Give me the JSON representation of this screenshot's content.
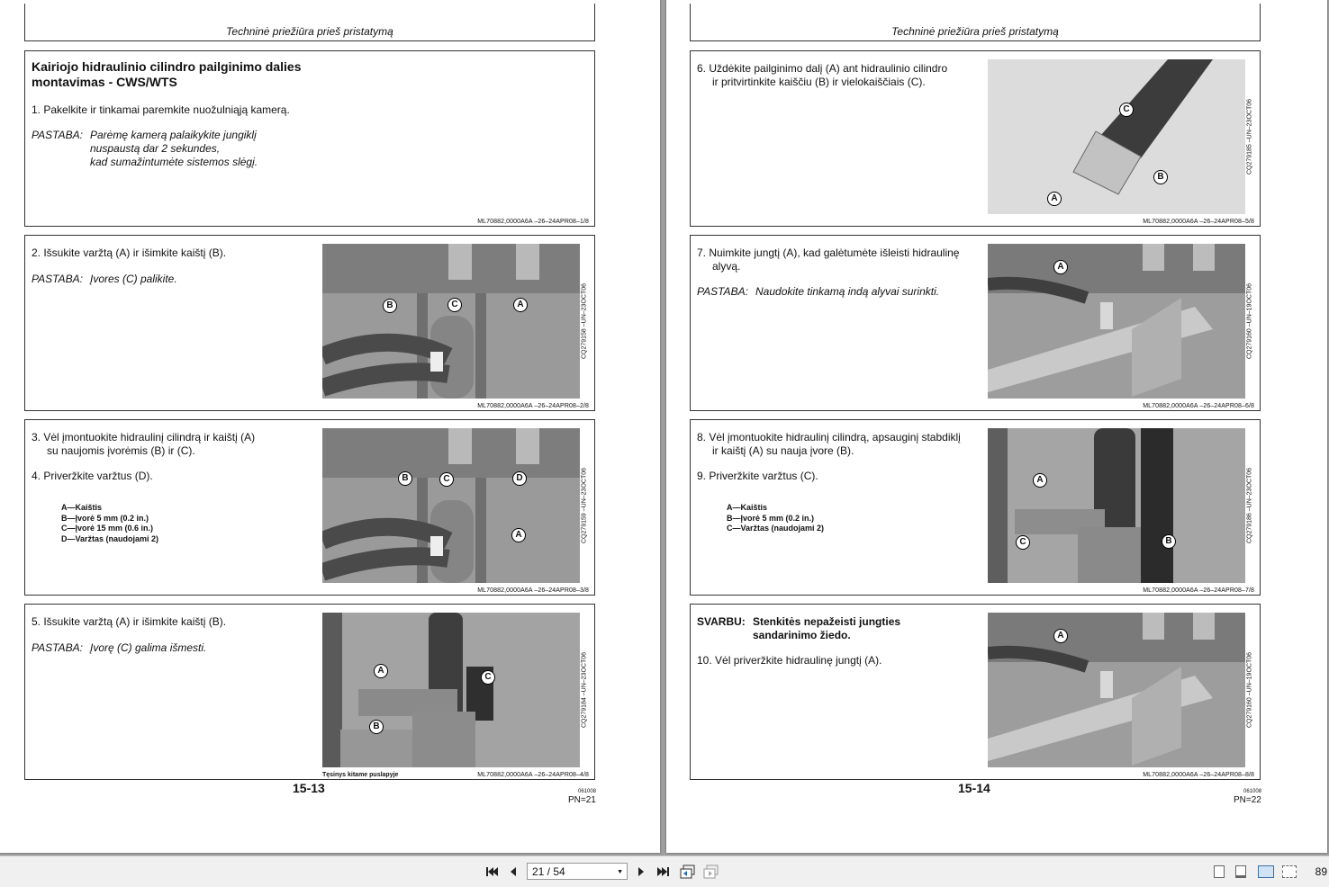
{
  "left_page": {
    "header": "Techninė priežiūra prieš pristatymą",
    "block1": {
      "title_line1": "Kairiojo hidraulinio cilindro pailginimo dalies",
      "title_line2": "montavimas - CWS/WTS",
      "step1": "1.  Pakelkite ir tinkamai paremkite nuožulniąją kamerą.",
      "note_label": "PASTABA:",
      "note_line1": "Parėmę kamerą palaikykite jungiklį",
      "note_line2": "nuspaustą dar 2 sekundes,",
      "note_line3": "kad sumažintumėte sistemos slėgį.",
      "ref": "ML70882,0000A6A   –26–24APR08–1/8"
    },
    "block2": {
      "step2": "2.  Išsukite varžtą (A) ir išimkite kaištį (B).",
      "note_label": "PASTABA:",
      "note": "Įvores (C) palikite.",
      "photo_code": "CQ279158   –UN–23OCT06",
      "ref": "ML70882,0000A6A   –26–24APR08–2/8",
      "callouts": [
        "B",
        "C",
        "A"
      ]
    },
    "block3": {
      "step3_line1": "3.  Vėl įmontuokite hidraulinį cilindrą ir kaištį (A)",
      "step3_line2": "su naujomis įvorėmis (B) ir (C).",
      "step4": "4.  Priveržkite varžtus (D).",
      "legend": [
        "A—Kaištis",
        "B—Įvorė 5 mm (0.2 in.)",
        "C—Įvorė 15 mm (0.6 in.)",
        "D—Varžtas (naudojami 2)"
      ],
      "photo_code": "CQ279159   –UN–23OCT06",
      "ref": "ML70882,0000A6A   –26–24APR08–3/8",
      "callouts": [
        "B",
        "C",
        "D",
        "A"
      ]
    },
    "block4": {
      "step5": "5.  Išsukite varžtą (A) ir išimkite kaištį (B).",
      "note_label": "PASTABA:",
      "note": "Įvorę (C) galima išmesti.",
      "photo_code": "CQ279184   –UN–23OCT06",
      "continued": "Tęsinys kitame puslapyje",
      "ref": "ML70882,0000A6A   –26–24APR08–4/8",
      "callouts": [
        "A",
        "C",
        "B"
      ]
    },
    "page_number": "15-13",
    "date": "061008",
    "pn": "PN=21"
  },
  "right_page": {
    "header": "Techninė priežiūra prieš pristatymą",
    "block1": {
      "step6_line1": "6.  Uždėkite pailginimo dalį (A) ant hidraulinio cilindro",
      "step6_line2": "ir pritvirtinkite kaiščiu (B) ir vielokaiščiais (C).",
      "photo_code": "CQ279185   –UN–23OCT06",
      "ref": "ML70882,0000A6A   –26–24APR08–5/8",
      "callouts": [
        "C",
        "B",
        "A"
      ]
    },
    "block2": {
      "step7_line1": "7.  Nuimkite jungtį (A), kad galėtumėte išleisti hidraulinę",
      "step7_line2": "alyvą.",
      "note_label": "PASTABA:",
      "note": "Naudokite tinkamą indą alyvai surinkti.",
      "photo_code": "CQ279160   –UN–19OCT06",
      "ref": "ML70882,0000A6A   –26–24APR08–6/8",
      "callouts": [
        "A"
      ]
    },
    "block3": {
      "step8_line1": "8.  Vėl įmontuokite hidraulinį cilindrą, apsauginį stabdiklį",
      "step8_line2": "ir kaištį (A) su nauja įvore (B).",
      "step9": "9.  Priveržkite varžtus (C).",
      "legend": [
        "A—Kaištis",
        "B—Įvorė 5 mm (0.2 in.)",
        "C—Varžtas (naudojami 2)"
      ],
      "photo_code": "CQ279186   –UN–23OCT06",
      "ref": "ML70882,0000A6A   –26–24APR08–7/8",
      "callouts": [
        "A",
        "C",
        "B"
      ]
    },
    "block4": {
      "important_label": "SVARBU:",
      "important_line1": "Stenkitės nepažeisti jungties",
      "important_line2": "sandarinimo žiedo.",
      "step10": "10.  Vėl priveržkite hidraulinę jungtį (A).",
      "photo_code": "CQ279160   –UN–19OCT06",
      "ref": "ML70882,0000A6A   –26–24APR08–8/8",
      "callouts": [
        "A"
      ]
    },
    "page_number": "15-14",
    "date": "061008",
    "pn": "PN=22"
  },
  "toolbar": {
    "first_icon": "first-page-icon",
    "prev_icon": "previous-page-icon",
    "page_indicator": "21 / 54",
    "next_icon": "next-page-icon",
    "last_icon": "last-page-icon",
    "zoom": "89"
  }
}
